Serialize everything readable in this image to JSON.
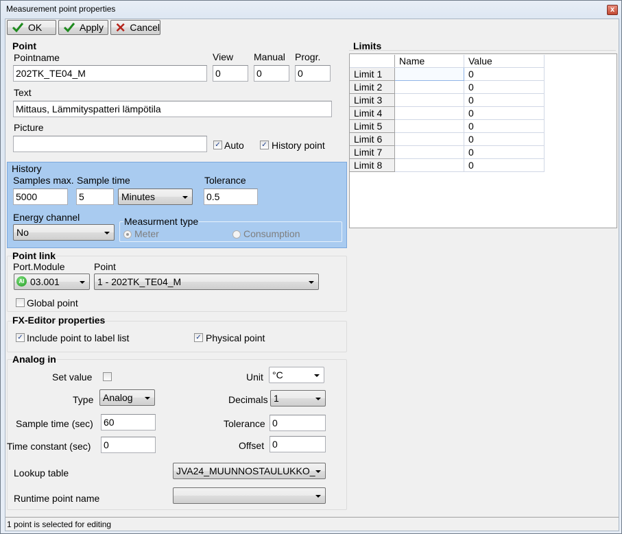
{
  "window": {
    "title": "Measurement point properties",
    "close_label": "x"
  },
  "toolbar": {
    "ok_label": "OK",
    "apply_label": "Apply",
    "cancel_label": "Cancel"
  },
  "point": {
    "section": "Point",
    "pointname_label": "Pointname",
    "pointname_value": "202TK_TE04_M",
    "view_label": "View",
    "view_value": "0",
    "manual_label": "Manual",
    "manual_value": "0",
    "progr_label": "Progr.",
    "progr_value": "0",
    "text_label": "Text",
    "text_value": "Mittaus, Lämmityspatteri lämpötila",
    "picture_label": "Picture",
    "picture_value": "",
    "auto_label": "Auto",
    "auto_checked": true,
    "history_point_label": "History point",
    "history_point_checked": true
  },
  "history": {
    "section": "History",
    "samples_max_label": "Samples max.",
    "samples_max_value": "5000",
    "sample_time_label": "Sample time",
    "sample_time_value": "5",
    "sample_time_unit": "Minutes",
    "tolerance_label": "Tolerance",
    "tolerance_value": "0.5",
    "energy_channel_label": "Energy channel",
    "energy_channel_value": "No",
    "measurement_type_label": "Measurment type",
    "meter_label": "Meter",
    "consumption_label": "Consumption",
    "selected": "Meter"
  },
  "point_link": {
    "section": "Point link",
    "port_module_label": "Port.Module",
    "port_module_value": "03.001",
    "port_badge": "AI",
    "point_label": "Point",
    "point_value": "1 - 202TK_TE04_M",
    "global_point_label": "Global point",
    "global_point_checked": false
  },
  "fx_editor": {
    "section": "FX-Editor properties",
    "include_label": "Include point to label list",
    "include_checked": true,
    "physical_label": "Physical point",
    "physical_checked": true
  },
  "analog_in": {
    "section": "Analog in",
    "set_value_label": "Set value",
    "set_value_checked": false,
    "unit_label": "Unit",
    "unit_value": "°C",
    "type_label": "Type",
    "type_value": "Analog",
    "decimals_label": "Decimals",
    "decimals_value": "1",
    "sample_time_label": "Sample time (sec)",
    "sample_time_value": "60",
    "tolerance_label": "Tolerance",
    "tolerance_value": "0",
    "time_constant_label": "Time constant (sec)",
    "time_constant_value": "0",
    "offset_label": "Offset",
    "offset_value": "0",
    "lookup_label": "Lookup table",
    "lookup_value": "JVA24_MUUNNOSTAULUKKO_",
    "runtime_label": "Runtime point name",
    "runtime_value": ""
  },
  "limits": {
    "section": "Limits",
    "columns": [
      "Name",
      "Value"
    ],
    "rows": [
      {
        "label": "Limit 1",
        "name": "",
        "value": "0"
      },
      {
        "label": "Limit 2",
        "name": "",
        "value": "0"
      },
      {
        "label": "Limit 3",
        "name": "",
        "value": "0"
      },
      {
        "label": "Limit 4",
        "name": "",
        "value": "0"
      },
      {
        "label": "Limit 5",
        "name": "",
        "value": "0"
      },
      {
        "label": "Limit 6",
        "name": "",
        "value": "0"
      },
      {
        "label": "Limit 7",
        "name": "",
        "value": "0"
      },
      {
        "label": "Limit 8",
        "name": "",
        "value": "0"
      }
    ]
  },
  "status": {
    "text": "1 point is selected for editing"
  }
}
